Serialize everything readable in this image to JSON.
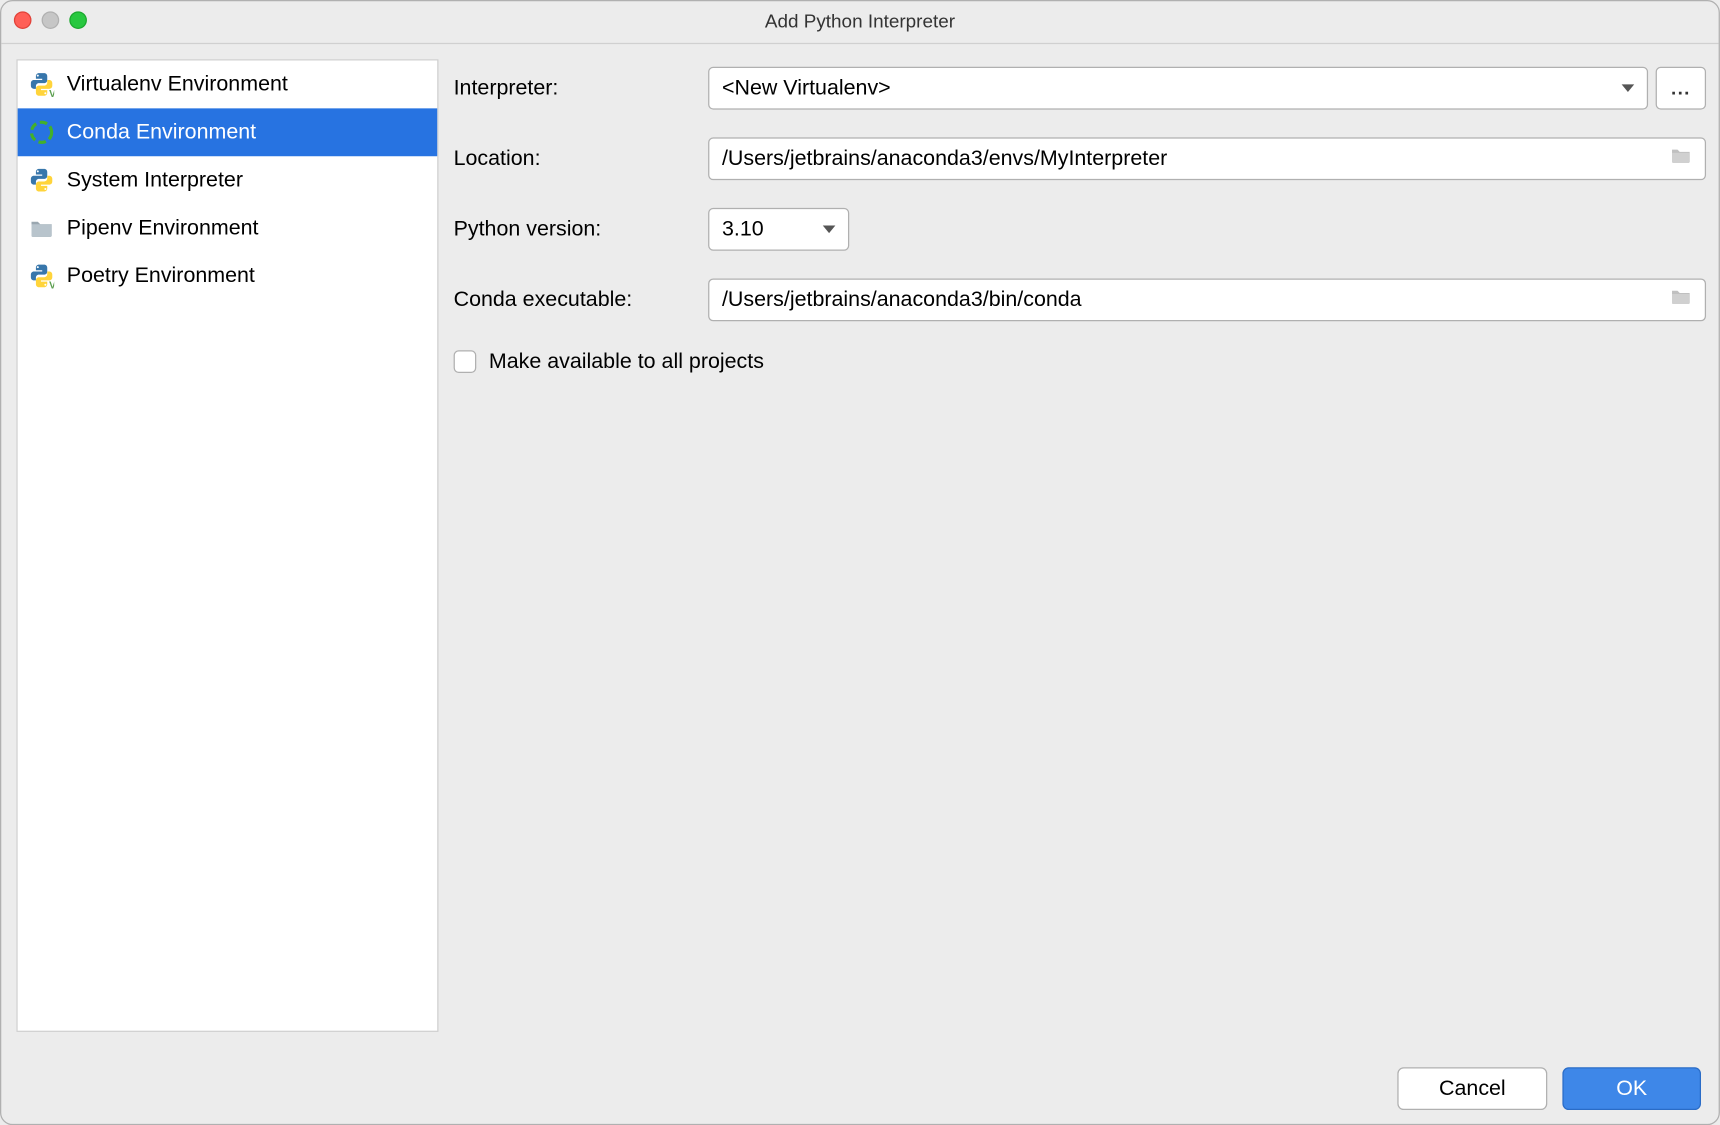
{
  "window": {
    "title": "Add Python Interpreter"
  },
  "sidebar": {
    "items": [
      {
        "label": "Virtualenv Environment",
        "icon": "python",
        "selected": false
      },
      {
        "label": "Conda Environment",
        "icon": "conda",
        "selected": true
      },
      {
        "label": "System Interpreter",
        "icon": "python",
        "selected": false
      },
      {
        "label": "Pipenv Environment",
        "icon": "folder",
        "selected": false
      },
      {
        "label": "Poetry Environment",
        "icon": "python",
        "selected": false
      }
    ]
  },
  "form": {
    "interpreter_label": "Interpreter:",
    "interpreter_value": "<New Virtualenv>",
    "more_button": "...",
    "location_label": "Location:",
    "location_value": "/Users/jetbrains/anaconda3/envs/MyInterpreter",
    "python_version_label": "Python version:",
    "python_version_value": "3.10",
    "conda_exec_label": "Conda executable:",
    "conda_exec_value": "/Users/jetbrains/anaconda3/bin/conda",
    "make_available_label": "Make available to all projects",
    "make_available_checked": false
  },
  "footer": {
    "cancel": "Cancel",
    "ok": "OK"
  }
}
